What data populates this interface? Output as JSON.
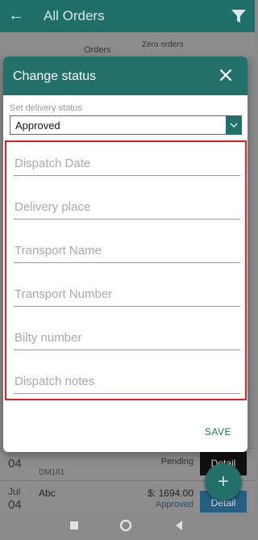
{
  "appbar": {
    "title": "All Orders"
  },
  "table_header": {
    "orders": "Orders",
    "zero_orders": "Zero\norders"
  },
  "background_rows": [
    {
      "day": "04",
      "code": "DM161",
      "status": "Pending",
      "detail": "Detail"
    },
    {
      "month": "Jul",
      "day": "04",
      "name": "Abc",
      "amount": "$: 1694.00",
      "status": "Approved",
      "detail": "Detail"
    }
  ],
  "dialog": {
    "title": "Change status",
    "status_label": "Set delivery status",
    "status_value": "Approved",
    "fields": [
      {
        "placeholder": "Dispatch Date"
      },
      {
        "placeholder": "Delivery place"
      },
      {
        "placeholder": "Transport Name"
      },
      {
        "placeholder": "Transport Number"
      },
      {
        "placeholder": "Bilty number"
      },
      {
        "placeholder": "Dispatch notes"
      }
    ],
    "save_label": "SAVE"
  },
  "colors": {
    "primary": "#23706a",
    "highlight_border": "#e02020"
  }
}
